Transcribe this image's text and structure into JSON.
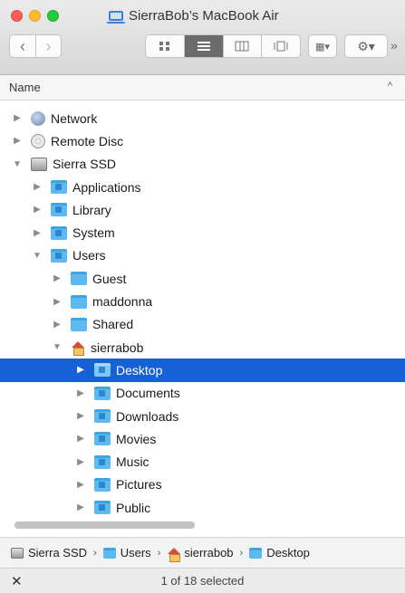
{
  "window": {
    "title": "SierraBob’s MacBook Air"
  },
  "toolbar": {
    "back": "‹",
    "forward": "›",
    "overflow": "»"
  },
  "header": {
    "name_column": "Name",
    "sort_indicator": "^"
  },
  "list": {
    "rows": [
      {
        "label": "Network",
        "depth": 0,
        "expanded": false,
        "icon": "network-globe-icon"
      },
      {
        "label": "Remote Disc",
        "depth": 0,
        "expanded": false,
        "icon": "remote-disc-icon"
      },
      {
        "label": "Sierra SSD",
        "depth": 0,
        "expanded": true,
        "icon": "hard-disk-icon"
      },
      {
        "label": "Applications",
        "depth": 1,
        "expanded": false,
        "icon": "applications-folder-icon"
      },
      {
        "label": "Library",
        "depth": 1,
        "expanded": false,
        "icon": "library-folder-icon"
      },
      {
        "label": "System",
        "depth": 1,
        "expanded": false,
        "icon": "system-folder-icon"
      },
      {
        "label": "Users",
        "depth": 1,
        "expanded": true,
        "icon": "users-folder-icon"
      },
      {
        "label": "Guest",
        "depth": 2,
        "expanded": false,
        "icon": "folder-icon"
      },
      {
        "label": "maddonna",
        "depth": 2,
        "expanded": false,
        "icon": "folder-icon"
      },
      {
        "label": "Shared",
        "depth": 2,
        "expanded": false,
        "icon": "folder-icon"
      },
      {
        "label": "sierrabob",
        "depth": 2,
        "expanded": true,
        "icon": "home-icon"
      },
      {
        "label": "Desktop",
        "depth": 3,
        "expanded": false,
        "selected": true,
        "icon": "desktop-folder-icon"
      },
      {
        "label": "Documents",
        "depth": 3,
        "expanded": false,
        "icon": "documents-folder-icon"
      },
      {
        "label": "Downloads",
        "depth": 3,
        "expanded": false,
        "icon": "downloads-folder-icon"
      },
      {
        "label": "Movies",
        "depth": 3,
        "expanded": false,
        "icon": "movies-folder-icon"
      },
      {
        "label": "Music",
        "depth": 3,
        "expanded": false,
        "icon": "music-folder-icon"
      },
      {
        "label": "Pictures",
        "depth": 3,
        "expanded": false,
        "icon": "pictures-folder-icon"
      },
      {
        "label": "Public",
        "depth": 3,
        "expanded": false,
        "icon": "public-folder-icon"
      }
    ]
  },
  "pathbar": {
    "crumbs": [
      "Sierra SSD",
      "Users",
      "sierrabob",
      "Desktop"
    ],
    "separator": "›"
  },
  "status": {
    "text": "1 of 18 selected"
  },
  "colors": {
    "selection": "#1661d6",
    "folder": "#5fb9f1"
  }
}
